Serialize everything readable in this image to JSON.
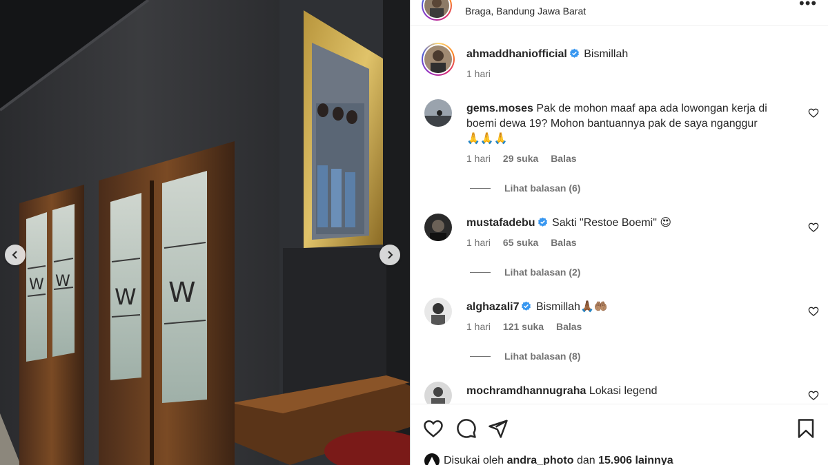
{
  "post": {
    "location": "Braga, Bandung Jawa Barat",
    "more_icon": "more-horizontal-icon"
  },
  "caption": {
    "username": "ahmaddhaniofficial",
    "text": "Bismillah",
    "time": "1 hari"
  },
  "comments": [
    {
      "username": "gems.moses",
      "verified": false,
      "text": "Pak de mohon maaf apa ada lowongan kerja di boemi dewa 19? Mohon bantuannya pak de saya nganggur",
      "emoji": "🙏🙏🙏",
      "time": "1 hari",
      "likes": "29 suka",
      "reply": "Balas",
      "view_replies": "Lihat balasan (6)"
    },
    {
      "username": "mustafadebu",
      "verified": true,
      "text": "Sakti \"Restoe Boemi\"",
      "emoji": "😍",
      "time": "1 hari",
      "likes": "65 suka",
      "reply": "Balas",
      "view_replies": "Lihat balasan (2)"
    },
    {
      "username": "alghazali7",
      "verified": true,
      "text": "Bismillah",
      "emoji": "🙏🏾🤲🏽",
      "time": "1 hari",
      "likes": "121 suka",
      "reply": "Balas",
      "view_replies": "Lihat balasan (8)"
    },
    {
      "username": "mochramdhannugraha",
      "verified": false,
      "text": "Lokasi legend",
      "emoji": ""
    }
  ],
  "likes_line": {
    "prefix": "Disukai oleh",
    "user": "andra_photo",
    "middle": "dan",
    "count": "15.906 lainnya"
  },
  "colors": {
    "verified_blue": "#3897f0",
    "text": "#262626",
    "muted": "#737373"
  }
}
